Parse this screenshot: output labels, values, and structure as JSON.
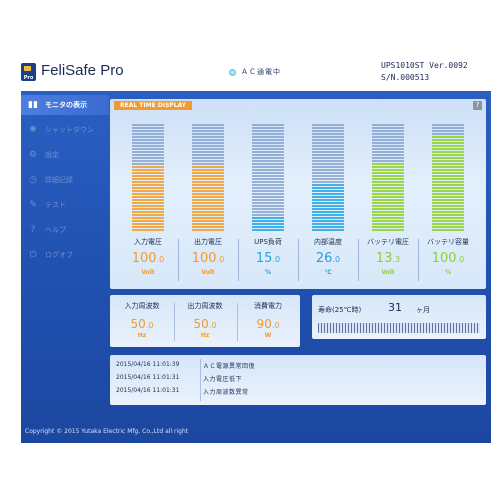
{
  "header": {
    "title": "FeliSafe Pro",
    "logo_badge": "Pro",
    "status": "ＡＣ通電中",
    "model": "UPS1010ST  Ver.0092",
    "serial": "S/N.000513"
  },
  "sidebar": {
    "items": [
      {
        "label": "モニタの表示",
        "icon": "bar-chart-icon",
        "active": true
      },
      {
        "label": "シャットダウン",
        "icon": "sun-icon",
        "active": false
      },
      {
        "label": "設定",
        "icon": "gear-icon",
        "active": false
      },
      {
        "label": "詳細記録",
        "icon": "clock-icon",
        "active": false
      },
      {
        "label": "テスト",
        "icon": "pencil-icon",
        "active": false
      },
      {
        "label": "ヘルプ",
        "icon": "question-icon",
        "active": false
      },
      {
        "label": "ログオフ",
        "icon": "power-icon",
        "active": false
      }
    ]
  },
  "realtime": {
    "label": "REAL TIME DISPLAY",
    "help": "?"
  },
  "gauges": [
    {
      "label": "入力電圧",
      "value": "100",
      "decimal": ".0",
      "unit": "Volt",
      "fill": 0.61,
      "color": "#f0a848"
    },
    {
      "label": "出力電圧",
      "value": "100",
      "decimal": ".0",
      "unit": "Volt",
      "fill": 0.61,
      "color": "#f0a848"
    },
    {
      "label": "UPS負荷",
      "value": "15",
      "decimal": ".0",
      "unit": "%",
      "fill": 0.15,
      "color": "#3fb0e8"
    },
    {
      "label": "内部温度",
      "value": "26",
      "decimal": ".0",
      "unit": "℃",
      "fill": 0.44,
      "color": "#3fb0e8"
    },
    {
      "label": "バッテリ電圧",
      "value": "13",
      "decimal": ".3",
      "unit": "Volt",
      "fill": 0.64,
      "color": "#9ad64a"
    },
    {
      "label": "バッテリ容量",
      "value": "100",
      "decimal": ".0",
      "unit": "%",
      "fill": 0.9,
      "color": "#9ad64a"
    }
  ],
  "frequency": [
    {
      "label": "入力周波数",
      "value": "50",
      "decimal": ".0",
      "unit": "Hz"
    },
    {
      "label": "出力周波数",
      "value": "50",
      "decimal": ".0",
      "unit": "Hz"
    },
    {
      "label": "消費電力",
      "value": "90",
      "decimal": ".0",
      "unit": "W"
    }
  ],
  "life": {
    "label": "寿命(25℃時)",
    "value": "31",
    "unit": "ヶ月"
  },
  "log": [
    {
      "time": "2015/04/16  11:01:39",
      "message": "ＡＣ電源異常回復"
    },
    {
      "time": "2015/04/16  11:01:31",
      "message": "入力電圧低下"
    },
    {
      "time": "2015/04/16  11:01:31",
      "message": "入力周波数異常"
    }
  ],
  "footer": {
    "copyright": "Copyright  ©  2015  Yutaka  Electric  Mfg.  Co.,Ltd  all  right"
  }
}
